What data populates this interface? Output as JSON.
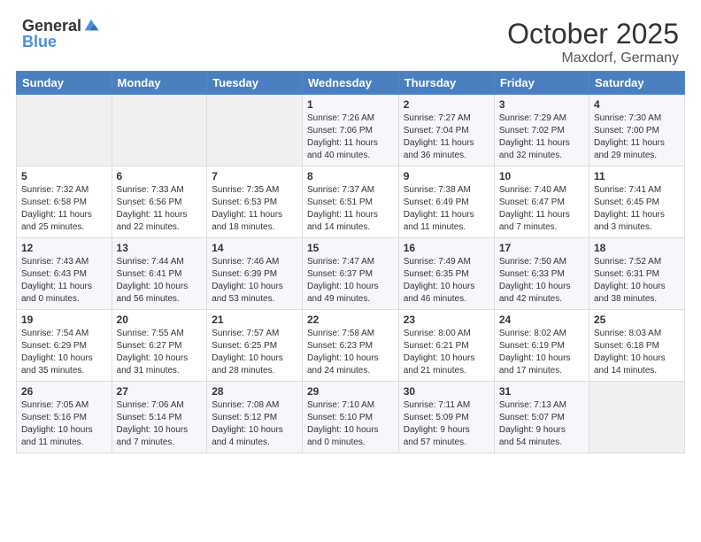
{
  "header": {
    "logo_general": "General",
    "logo_blue": "Blue",
    "month": "October 2025",
    "location": "Maxdorf, Germany"
  },
  "days_of_week": [
    "Sunday",
    "Monday",
    "Tuesday",
    "Wednesday",
    "Thursday",
    "Friday",
    "Saturday"
  ],
  "weeks": [
    [
      {
        "day": "",
        "content": ""
      },
      {
        "day": "",
        "content": ""
      },
      {
        "day": "",
        "content": ""
      },
      {
        "day": "1",
        "content": "Sunrise: 7:26 AM\nSunset: 7:06 PM\nDaylight: 11 hours\nand 40 minutes."
      },
      {
        "day": "2",
        "content": "Sunrise: 7:27 AM\nSunset: 7:04 PM\nDaylight: 11 hours\nand 36 minutes."
      },
      {
        "day": "3",
        "content": "Sunrise: 7:29 AM\nSunset: 7:02 PM\nDaylight: 11 hours\nand 32 minutes."
      },
      {
        "day": "4",
        "content": "Sunrise: 7:30 AM\nSunset: 7:00 PM\nDaylight: 11 hours\nand 29 minutes."
      }
    ],
    [
      {
        "day": "5",
        "content": "Sunrise: 7:32 AM\nSunset: 6:58 PM\nDaylight: 11 hours\nand 25 minutes."
      },
      {
        "day": "6",
        "content": "Sunrise: 7:33 AM\nSunset: 6:56 PM\nDaylight: 11 hours\nand 22 minutes."
      },
      {
        "day": "7",
        "content": "Sunrise: 7:35 AM\nSunset: 6:53 PM\nDaylight: 11 hours\nand 18 minutes."
      },
      {
        "day": "8",
        "content": "Sunrise: 7:37 AM\nSunset: 6:51 PM\nDaylight: 11 hours\nand 14 minutes."
      },
      {
        "day": "9",
        "content": "Sunrise: 7:38 AM\nSunset: 6:49 PM\nDaylight: 11 hours\nand 11 minutes."
      },
      {
        "day": "10",
        "content": "Sunrise: 7:40 AM\nSunset: 6:47 PM\nDaylight: 11 hours\nand 7 minutes."
      },
      {
        "day": "11",
        "content": "Sunrise: 7:41 AM\nSunset: 6:45 PM\nDaylight: 11 hours\nand 3 minutes."
      }
    ],
    [
      {
        "day": "12",
        "content": "Sunrise: 7:43 AM\nSunset: 6:43 PM\nDaylight: 11 hours\nand 0 minutes."
      },
      {
        "day": "13",
        "content": "Sunrise: 7:44 AM\nSunset: 6:41 PM\nDaylight: 10 hours\nand 56 minutes."
      },
      {
        "day": "14",
        "content": "Sunrise: 7:46 AM\nSunset: 6:39 PM\nDaylight: 10 hours\nand 53 minutes."
      },
      {
        "day": "15",
        "content": "Sunrise: 7:47 AM\nSunset: 6:37 PM\nDaylight: 10 hours\nand 49 minutes."
      },
      {
        "day": "16",
        "content": "Sunrise: 7:49 AM\nSunset: 6:35 PM\nDaylight: 10 hours\nand 46 minutes."
      },
      {
        "day": "17",
        "content": "Sunrise: 7:50 AM\nSunset: 6:33 PM\nDaylight: 10 hours\nand 42 minutes."
      },
      {
        "day": "18",
        "content": "Sunrise: 7:52 AM\nSunset: 6:31 PM\nDaylight: 10 hours\nand 38 minutes."
      }
    ],
    [
      {
        "day": "19",
        "content": "Sunrise: 7:54 AM\nSunset: 6:29 PM\nDaylight: 10 hours\nand 35 minutes."
      },
      {
        "day": "20",
        "content": "Sunrise: 7:55 AM\nSunset: 6:27 PM\nDaylight: 10 hours\nand 31 minutes."
      },
      {
        "day": "21",
        "content": "Sunrise: 7:57 AM\nSunset: 6:25 PM\nDaylight: 10 hours\nand 28 minutes."
      },
      {
        "day": "22",
        "content": "Sunrise: 7:58 AM\nSunset: 6:23 PM\nDaylight: 10 hours\nand 24 minutes."
      },
      {
        "day": "23",
        "content": "Sunrise: 8:00 AM\nSunset: 6:21 PM\nDaylight: 10 hours\nand 21 minutes."
      },
      {
        "day": "24",
        "content": "Sunrise: 8:02 AM\nSunset: 6:19 PM\nDaylight: 10 hours\nand 17 minutes."
      },
      {
        "day": "25",
        "content": "Sunrise: 8:03 AM\nSunset: 6:18 PM\nDaylight: 10 hours\nand 14 minutes."
      }
    ],
    [
      {
        "day": "26",
        "content": "Sunrise: 7:05 AM\nSunset: 5:16 PM\nDaylight: 10 hours\nand 11 minutes."
      },
      {
        "day": "27",
        "content": "Sunrise: 7:06 AM\nSunset: 5:14 PM\nDaylight: 10 hours\nand 7 minutes."
      },
      {
        "day": "28",
        "content": "Sunrise: 7:08 AM\nSunset: 5:12 PM\nDaylight: 10 hours\nand 4 minutes."
      },
      {
        "day": "29",
        "content": "Sunrise: 7:10 AM\nSunset: 5:10 PM\nDaylight: 10 hours\nand 0 minutes."
      },
      {
        "day": "30",
        "content": "Sunrise: 7:11 AM\nSunset: 5:09 PM\nDaylight: 9 hours\nand 57 minutes."
      },
      {
        "day": "31",
        "content": "Sunrise: 7:13 AM\nSunset: 5:07 PM\nDaylight: 9 hours\nand 54 minutes."
      },
      {
        "day": "",
        "content": ""
      }
    ]
  ]
}
